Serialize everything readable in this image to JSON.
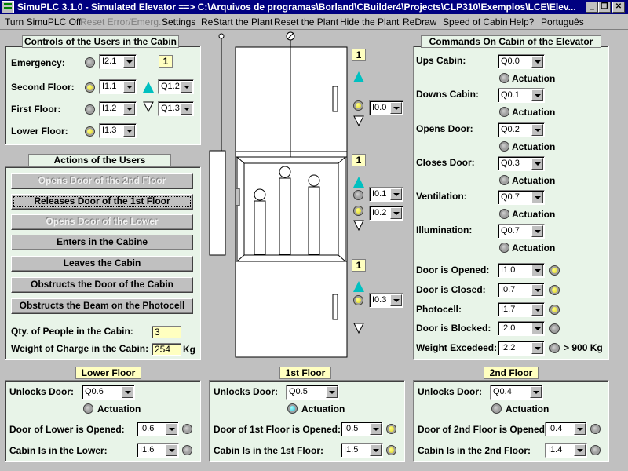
{
  "window": {
    "title": "SimuPLC 3.1.0 - Simulated Elevator ==> C:\\Arquivos de programas\\Borland\\CBuilder4\\Projects\\CLP310\\Exemplos\\LCE\\Elev..."
  },
  "menu": [
    "Turn SimuPLC Off",
    "Reset Error/Emerg.",
    "Settings",
    "ReStart the Plant",
    "Reset the Plant",
    "Hide the Plant",
    "ReDraw",
    "Speed of Cabin",
    "Help?",
    "Português"
  ],
  "cabin_controls": {
    "title": "Controls of the Users in the Cabin",
    "rows": [
      {
        "label": "Emergency:",
        "led": "gray",
        "input": "I2.1",
        "counter": "1"
      },
      {
        "label": "Second Floor:",
        "led": "yellow",
        "input": "I1.1",
        "output": "Q1.2",
        "arrow": "up-cyan"
      },
      {
        "label": "First Floor:",
        "led": "gray",
        "input": "I1.2",
        "output": "Q1.3",
        "arrow": "down-outline"
      },
      {
        "label": "Lower Floor:",
        "led": "yellow",
        "input": "I1.3"
      }
    ]
  },
  "actions": {
    "title": "Actions of the Users",
    "buttons": [
      {
        "label": "Opens Door of the 2nd Floor",
        "enabled": false
      },
      {
        "label": "Releases Door of the 1st Floor",
        "enabled": true,
        "focused": true
      },
      {
        "label": "Opens Door of the Lower",
        "enabled": false
      },
      {
        "label": "Enters in the Cabine",
        "enabled": true
      },
      {
        "label": "Leaves the Cabin",
        "enabled": true
      },
      {
        "label": "Obstructs the Door of the Cabin",
        "enabled": true
      },
      {
        "label": "Obstructs the Beam on the Photocell",
        "enabled": true
      }
    ],
    "qty_label": "Qty. of People in the Cabin:",
    "qty_value": "3",
    "weight_label": "Weight of Charge in the Cabin:",
    "weight_value": "254",
    "weight_unit": "Kg"
  },
  "shaft": {
    "floor3": {
      "counter": "1"
    },
    "floor2": {
      "counter": "1",
      "input1": "I0.1",
      "input2": "I0.2"
    },
    "floor1": {
      "counter": "1",
      "input": "I0.3"
    },
    "top": {
      "input": "I0.0"
    }
  },
  "commands": {
    "title": "Commands On Cabin of the Elevator",
    "actuation_label": "Actuation",
    "outputs": [
      {
        "label": "Ups Cabin:",
        "value": "Q0.0"
      },
      {
        "label": "Downs Cabin:",
        "value": "Q0.1"
      },
      {
        "label": "Opens Door:",
        "value": "Q0.2"
      },
      {
        "label": "Closes Door:",
        "value": "Q0.3"
      },
      {
        "label": "Ventilation:",
        "value": "Q0.7"
      },
      {
        "label": "Illumination:",
        "value": "Q0.7"
      }
    ],
    "inputs": [
      {
        "label": "Door is Opened:",
        "value": "I1.0",
        "led": "yellow"
      },
      {
        "label": "Door is Closed:",
        "value": "I0.7",
        "led": "yellow"
      },
      {
        "label": "Photocell:",
        "value": "I1.7",
        "led": "yellow"
      },
      {
        "label": "Door is Blocked:",
        "value": "I2.0",
        "led": "gray"
      },
      {
        "label": "Weight Excedeed:",
        "value": "I2.2",
        "led": "gray",
        "suffix": "> 900 Kg"
      }
    ]
  },
  "floors": [
    {
      "title": "Lower Floor",
      "unlock_label": "Unlocks Door:",
      "unlock_value": "Q0.6",
      "actuation": "Actuation",
      "actuation_led": "gray",
      "opened_label": "Door of Lower is Opened:",
      "opened_value": "I0.6",
      "opened_led": "gray",
      "cabin_label": "Cabin Is in the Lower:",
      "cabin_value": "I1.6",
      "cabin_led": "gray"
    },
    {
      "title": "1st Floor",
      "unlock_label": "Unlocks Door:",
      "unlock_value": "Q0.5",
      "actuation": "Actuation",
      "actuation_led": "cyan",
      "opened_label": "Door of 1st Floor is Opened:",
      "opened_value": "I0.5",
      "opened_led": "yellow",
      "cabin_label": "Cabin Is in the 1st Floor:",
      "cabin_value": "I1.5",
      "cabin_led": "yellow"
    },
    {
      "title": "2nd Floor",
      "unlock_label": "Unlocks Door:",
      "unlock_value": "Q0.4",
      "actuation": "Actuation",
      "actuation_led": "gray",
      "opened_label": "Door of 2nd Floor is Opened:",
      "opened_value": "I0.4",
      "opened_led": "gray",
      "cabin_label": "Cabin Is in the 2nd Floor:",
      "cabin_value": "I1.4",
      "cabin_led": "gray"
    }
  ],
  "colors": {
    "panel": "#e8f4e8",
    "title_bar": "#000080",
    "highlight": "#ffffc0"
  }
}
